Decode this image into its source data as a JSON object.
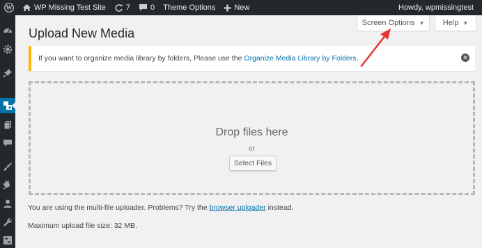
{
  "adminbar": {
    "site_name": "WP Missing Test Site",
    "updates_count": "7",
    "comments_count": "0",
    "theme_options": "Theme Options",
    "new_label": "New",
    "greeting": "Howdy, wpmissingtest"
  },
  "tabs": {
    "screen_options": "Screen Options",
    "help": "Help"
  },
  "page": {
    "title": "Upload New Media"
  },
  "notice": {
    "text": "If you want to organize media library by folders, Please use the",
    "link": "Organize Media Library by Folders",
    "end": "."
  },
  "dropzone": {
    "title": "Drop files here",
    "or": "or",
    "button": "Select Files"
  },
  "info": {
    "uploader_prefix": "You are using the multi-file uploader. Problems? Try the",
    "uploader_link": "browser uploader",
    "uploader_suffix": "instead.",
    "max_size": "Maximum upload file size: 32 MB."
  },
  "colors": {
    "adminbar_bg": "#23282d",
    "accent": "#0073aa",
    "notice_border": "#ffb900",
    "annotation": "#e53935"
  }
}
